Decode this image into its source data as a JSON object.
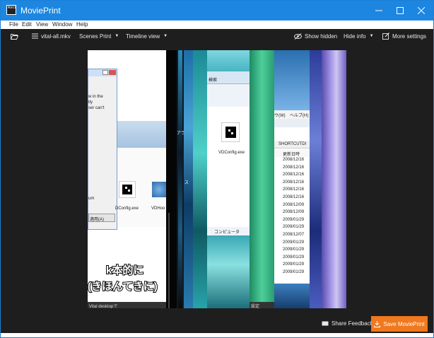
{
  "window": {
    "title": "MoviePrint",
    "app_icon_text": "MOVIEPRINT"
  },
  "menu": [
    "File",
    "Edit",
    "View",
    "Window",
    "Help"
  ],
  "toolbar": {
    "filename": "vital-all.mkv",
    "scenes_print": "Scenes Print",
    "timeline_view": "Timeline view",
    "show_hidden": "Show hidden",
    "hide_info": "Hide info",
    "more_settings": "More settings"
  },
  "thumbs": {
    "dialog_text_1": "w in the",
    "dialog_text_2": "tly",
    "dialog_text_3": "ser can't",
    "dialog_text_4": "um",
    "dialog_button": "適用(A)",
    "vdconfig_left": "DConfig.exe",
    "vdhook": "VDHoo",
    "subtitle_line1": "k本的に",
    "subtitle_line2": "(きほんてきに)",
    "taskbar_left": "Vital desktopで",
    "ja_vertical": "アラ",
    "ja_spanish": "ス",
    "vdconfig_center": "VDConfig.exe",
    "computer_label": "コンピュータ",
    "search_label": "検索",
    "menu_view": "ウ(W)",
    "menu_help": "ヘルプ(H)",
    "shortcut_header": "SHORTCUTDI",
    "date_header": "更新日時",
    "dates": [
      "2008/12/16",
      "2008/12/16",
      "2008/12/16",
      "2008/12/16",
      "2008/12/16",
      "2008/12/16",
      "2008/12/09",
      "2008/12/09",
      "2009/01/29",
      "2009/01/29",
      "2008/12/07",
      "2009/01/29",
      "2009/01/29",
      "2009/01/29",
      "2009/01/29",
      "2009/01/29"
    ],
    "taskbar_settings": "設定"
  },
  "footer": {
    "share_feedback": "Share Feedback",
    "save": "Save MoviePrint"
  },
  "colors": {
    "titlebar": "#1d86e0",
    "dark": "#1e1e1e",
    "accent": "#f0781e"
  }
}
